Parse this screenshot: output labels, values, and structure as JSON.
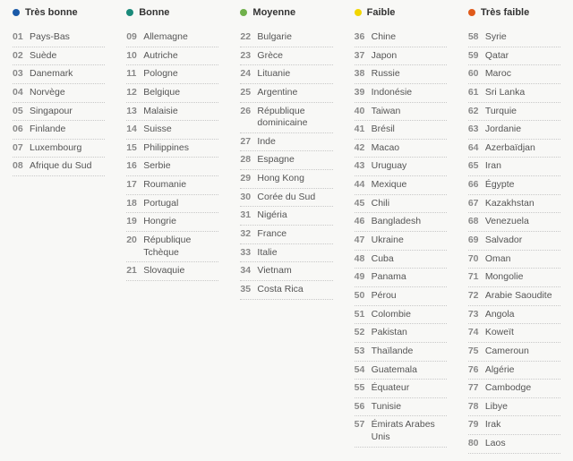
{
  "columns": [
    {
      "label": "Très bonne",
      "color": "#1a5aa8",
      "items": [
        {
          "rank": "01",
          "country": "Pays-Bas"
        },
        {
          "rank": "02",
          "country": "Suède"
        },
        {
          "rank": "03",
          "country": "Danemark"
        },
        {
          "rank": "04",
          "country": "Norvège"
        },
        {
          "rank": "05",
          "country": "Singapour"
        },
        {
          "rank": "06",
          "country": "Finlande"
        },
        {
          "rank": "07",
          "country": "Luxembourg"
        },
        {
          "rank": "08",
          "country": "Afrique du Sud"
        }
      ]
    },
    {
      "label": "Bonne",
      "color": "#1a8a7a",
      "items": [
        {
          "rank": "09",
          "country": "Allemagne"
        },
        {
          "rank": "10",
          "country": "Autriche"
        },
        {
          "rank": "11",
          "country": "Pologne"
        },
        {
          "rank": "12",
          "country": "Belgique"
        },
        {
          "rank": "13",
          "country": "Malaisie"
        },
        {
          "rank": "14",
          "country": "Suisse"
        },
        {
          "rank": "15",
          "country": "Philippines"
        },
        {
          "rank": "16",
          "country": "Serbie"
        },
        {
          "rank": "17",
          "country": "Roumanie"
        },
        {
          "rank": "18",
          "country": "Portugal"
        },
        {
          "rank": "19",
          "country": "Hongrie"
        },
        {
          "rank": "20",
          "country": "République Tchèque"
        },
        {
          "rank": "21",
          "country": "Slovaquie"
        }
      ]
    },
    {
      "label": "Moyenne",
      "color": "#6fb04a",
      "items": [
        {
          "rank": "22",
          "country": "Bulgarie"
        },
        {
          "rank": "23",
          "country": "Grèce"
        },
        {
          "rank": "24",
          "country": "Lituanie"
        },
        {
          "rank": "25",
          "country": "Argentine"
        },
        {
          "rank": "26",
          "country": "République dominicaine"
        },
        {
          "rank": "27",
          "country": "Inde"
        },
        {
          "rank": "28",
          "country": "Espagne"
        },
        {
          "rank": "29",
          "country": "Hong Kong"
        },
        {
          "rank": "30",
          "country": "Corée du Sud"
        },
        {
          "rank": "31",
          "country": "Nigéria"
        },
        {
          "rank": "32",
          "country": "France"
        },
        {
          "rank": "33",
          "country": "Italie"
        },
        {
          "rank": "34",
          "country": "Vietnam"
        },
        {
          "rank": "35",
          "country": "Costa Rica"
        }
      ]
    },
    {
      "label": "Faible",
      "color": "#f2d600",
      "items": [
        {
          "rank": "36",
          "country": "Chine"
        },
        {
          "rank": "37",
          "country": "Japon"
        },
        {
          "rank": "38",
          "country": "Russie"
        },
        {
          "rank": "39",
          "country": "Indonésie"
        },
        {
          "rank": "40",
          "country": "Taiwan"
        },
        {
          "rank": "41",
          "country": "Brésil"
        },
        {
          "rank": "42",
          "country": "Macao"
        },
        {
          "rank": "43",
          "country": "Uruguay"
        },
        {
          "rank": "44",
          "country": "Mexique"
        },
        {
          "rank": "45",
          "country": "Chili"
        },
        {
          "rank": "46",
          "country": "Bangladesh"
        },
        {
          "rank": "47",
          "country": "Ukraine"
        },
        {
          "rank": "48",
          "country": "Cuba"
        },
        {
          "rank": "49",
          "country": "Panama"
        },
        {
          "rank": "50",
          "country": "Pérou"
        },
        {
          "rank": "51",
          "country": "Colombie"
        },
        {
          "rank": "52",
          "country": "Pakistan"
        },
        {
          "rank": "53",
          "country": "Thaïlande"
        },
        {
          "rank": "54",
          "country": "Guatemala"
        },
        {
          "rank": "55",
          "country": "Équateur"
        },
        {
          "rank": "56",
          "country": "Tunisie"
        },
        {
          "rank": "57",
          "country": "Émirats Arabes Unis"
        }
      ]
    },
    {
      "label": "Très faible",
      "color": "#e05a1a",
      "items": [
        {
          "rank": "58",
          "country": "Syrie"
        },
        {
          "rank": "59",
          "country": "Qatar"
        },
        {
          "rank": "60",
          "country": "Maroc"
        },
        {
          "rank": "61",
          "country": "Sri Lanka"
        },
        {
          "rank": "62",
          "country": "Turquie"
        },
        {
          "rank": "63",
          "country": "Jordanie"
        },
        {
          "rank": "64",
          "country": "Azerbaïdjan"
        },
        {
          "rank": "65",
          "country": "Iran"
        },
        {
          "rank": "66",
          "country": "Égypte"
        },
        {
          "rank": "67",
          "country": "Kazakhstan"
        },
        {
          "rank": "68",
          "country": "Venezuela"
        },
        {
          "rank": "69",
          "country": "Salvador"
        },
        {
          "rank": "70",
          "country": "Oman"
        },
        {
          "rank": "71",
          "country": "Mongolie"
        },
        {
          "rank": "72",
          "country": "Arabie Saoudite"
        },
        {
          "rank": "73",
          "country": "Angola"
        },
        {
          "rank": "74",
          "country": "Koweït"
        },
        {
          "rank": "75",
          "country": "Cameroun"
        },
        {
          "rank": "76",
          "country": "Algérie"
        },
        {
          "rank": "77",
          "country": "Cambodge"
        },
        {
          "rank": "78",
          "country": "Libye"
        },
        {
          "rank": "79",
          "country": "Irak"
        },
        {
          "rank": "80",
          "country": "Laos"
        }
      ]
    }
  ]
}
